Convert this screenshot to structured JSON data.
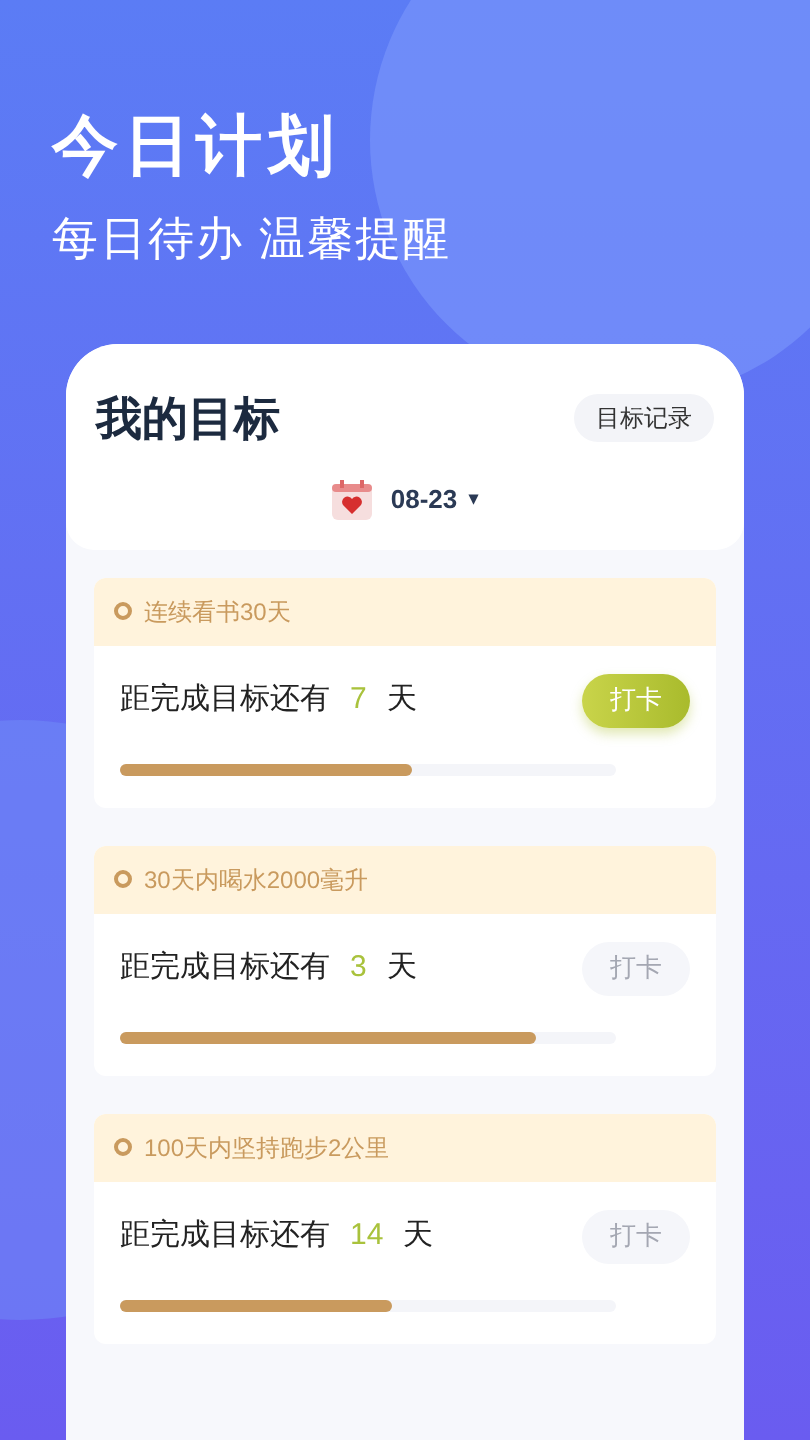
{
  "hero": {
    "title": "今日计划",
    "subtitle": "每日待办 温馨提醒"
  },
  "card": {
    "title": "我的目标",
    "records_button": "目标记录",
    "date": "08-23",
    "caret": "▾"
  },
  "goals": [
    {
      "title": "连续看书30天",
      "prefix": "距完成目标还有",
      "days": "7",
      "suffix": "天",
      "level": 0.59,
      "button": "打卡",
      "disabled": false
    },
    {
      "title": "30天内喝水2000毫升",
      "prefix": "距完成目标还有",
      "days": "3",
      "suffix": "天",
      "level": 0.84,
      "button": "打卡",
      "disabled": true
    },
    {
      "title": "100天内坚持跑步2公里",
      "prefix": "距完成目标还有",
      "days": "14",
      "suffix": "天",
      "level": 0.55,
      "button": "打卡",
      "disabled": true
    }
  ]
}
